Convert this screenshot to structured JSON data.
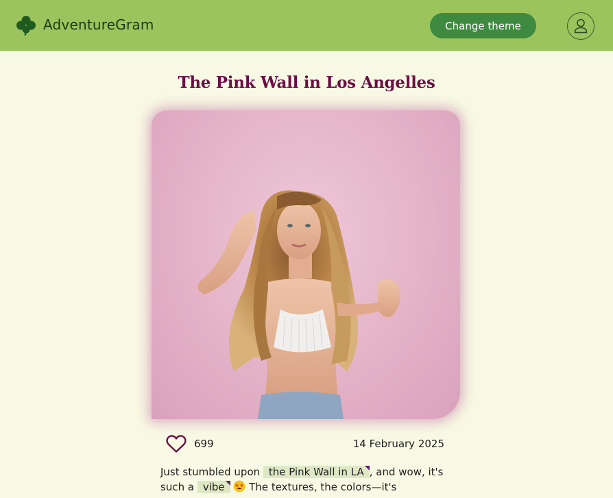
{
  "header": {
    "brand_name": "AdventureGram",
    "brand_icon": "clover-icon",
    "theme_button_label": "Change theme",
    "profile_icon": "user-icon"
  },
  "post": {
    "title": "The Pink Wall in Los Angelles",
    "image_alt": "Woman with long wavy hair against a pink wall",
    "like_icon": "heart-outline-icon",
    "likes": "699",
    "date": "14 February 2025",
    "text": {
      "part1": "Just stumbled upon ",
      "tag1": "the Pink Wall in LA",
      "part2": ", and wow, it's such a ",
      "tag2": "vibe",
      "emoji": "star-struck-emoji",
      "part3": " The textures, the colors—it's"
    }
  },
  "colors": {
    "header_bg": "#9bc45d",
    "page_bg": "#f8f9e4",
    "button_bg": "#3e8a3f",
    "title": "#6b0f45",
    "heart": "#6b0f45",
    "tag_bg": "#dfe8c5"
  }
}
